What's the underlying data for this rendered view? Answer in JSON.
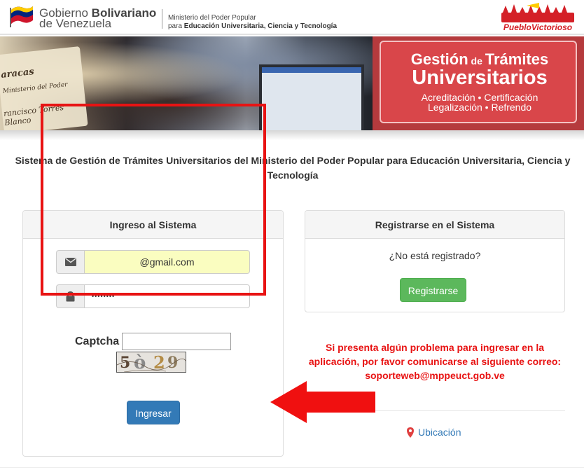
{
  "header": {
    "gov_name_line1_a": "Gobierno ",
    "gov_name_line1_b": "Bolivariano",
    "gov_name_line2": "de Venezuela",
    "ministry_line1": "Ministerio del Poder Popular",
    "ministry_line2_a": "para ",
    "ministry_line2_b": "Educación Universitaria, Ciencia y Tecnología",
    "pueblo_logo_text": "PuebloVictorioso"
  },
  "banner": {
    "title_a": "Gestión",
    "title_de": " de ",
    "title_b": "Trámites",
    "title_line2": "Universitarios",
    "line3": "Acreditación • Certificación",
    "line4": "Legalización • Refrendo",
    "diploma_text": [
      "aracas",
      "Ministerio del Poder",
      "rancisco Torres Blanco"
    ]
  },
  "page": {
    "system_title": "Sistema de Gestión de Trámites Universitarios del Ministerio del Poder Popular para Educación Universitaria, Ciencia y Tecnología"
  },
  "login": {
    "heading": "Ingreso al Sistema",
    "email_value": "@gmail.com",
    "password_value": "••••••••",
    "captcha_label": "Captcha",
    "captcha_value": "",
    "captcha_chars": "5 ò 2 9",
    "submit_label": "Ingresar"
  },
  "register": {
    "heading": "Registrarse en el Sistema",
    "question": "¿No está registrado?",
    "button_label": "Registrarse"
  },
  "help": {
    "message": "Si presenta algún problema para ingresar en la aplicación, por favor comunicarse al siguiente correo: soporteweb@mppeuct.gob.ve"
  },
  "location": {
    "label": "Ubicación"
  },
  "colors": {
    "annotation_red": "#e81313",
    "primary_blue": "#337ab7",
    "success_green": "#5cb85c",
    "email_fill": "#fafdc0",
    "banner_red": "#d9464a"
  },
  "icons": {
    "email_addon": "envelope-icon",
    "password_addon": "lock-icon",
    "location": "map-marker-icon"
  }
}
